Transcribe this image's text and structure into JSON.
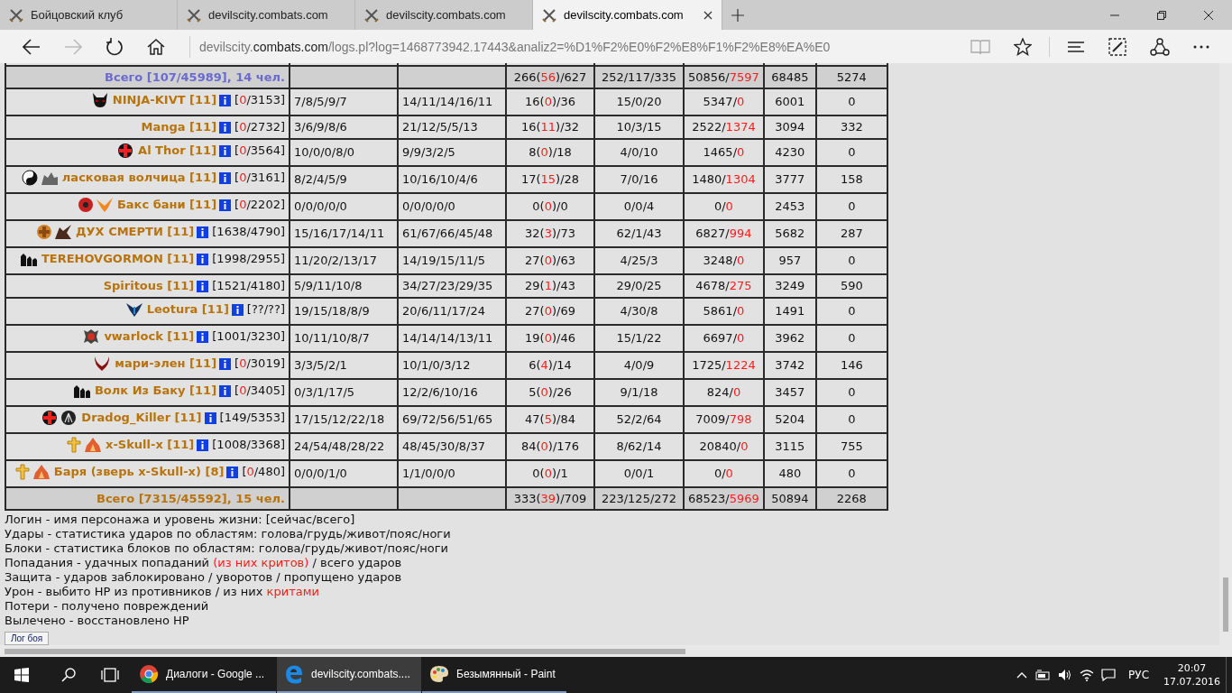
{
  "browser": {
    "tabs": [
      {
        "label": "Бойцовский клуб",
        "selected": false
      },
      {
        "label": "devilscity.combats.com",
        "selected": false
      },
      {
        "label": "devilscity.combats.com",
        "selected": false
      },
      {
        "label": "devilscity.combats.com",
        "selected": true
      }
    ],
    "address": {
      "prefix": "devilscity.",
      "domain": "combats.com",
      "rest": "/logs.pl?log=1468773942.17443&analiz2=%D1%F2%E0%F2%E8%F1%F2%E8%EA%E0"
    }
  },
  "table": {
    "rows": [
      {
        "kind": "total",
        "label": "Всего [107/45989], 14 чел.",
        "color": "#6a6ad0",
        "hit": "266(",
        "crit": "56",
        "attempts": ")/627",
        "defense": "252/117/335",
        "damage": "50856/",
        "crit_damage": "7597",
        "losses": "68485",
        "healed": "5274"
      },
      {
        "kind": "player",
        "emblems": [
          {
            "kind": "demon"
          }
        ],
        "name": "NINJA-KIVT [11]",
        "hp_open": "[",
        "hp": "0",
        "hp_rest": "/3153]",
        "dead": true,
        "hits": "7/8/5/9/7",
        "blocks": "14/11/14/16/11",
        "hit": "16(",
        "crit": "0",
        "attempts": ")/36",
        "defense": "15/0/20",
        "damage": "5347/",
        "crit_damage": "0",
        "losses": "6001",
        "healed": "0"
      },
      {
        "kind": "player",
        "emblems": [],
        "name": "Manga [11]",
        "hp_open": "[",
        "hp": "0",
        "hp_rest": "/2732]",
        "dead": true,
        "hits": "3/6/9/8/6",
        "blocks": "21/12/5/5/13",
        "hit": "16(",
        "crit": "11",
        "attempts": ")/32",
        "defense": "10/3/15",
        "damage": "2522/",
        "crit_damage": "1374",
        "losses": "3094",
        "healed": "332"
      },
      {
        "kind": "player",
        "emblems": [
          {
            "kind": "cross"
          }
        ],
        "name": "Al Thor [11]",
        "hp_open": "[",
        "hp": "0",
        "hp_rest": "/3564]",
        "dead": true,
        "hits": "10/0/0/8/0",
        "blocks": "9/9/3/2/5",
        "hit": "8(",
        "crit": "0",
        "attempts": ")/18",
        "defense": "4/0/10",
        "damage": "1465/",
        "crit_damage": "0",
        "losses": "4230",
        "healed": "0"
      },
      {
        "kind": "player",
        "emblems": [
          {
            "kind": "yinyang"
          },
          {
            "kind": "wolf"
          }
        ],
        "name": "ласковая волчица [11]",
        "hp_open": "[",
        "hp": "0",
        "hp_rest": "/3161]",
        "dead": true,
        "hits": "8/2/4/5/9",
        "blocks": "10/16/10/4/6",
        "hit": "17(",
        "crit": "15",
        "attempts": ")/28",
        "defense": "7/0/16",
        "damage": "1480/",
        "crit_damage": "1304",
        "losses": "3777",
        "healed": "158"
      },
      {
        "kind": "player",
        "emblems": [
          {
            "kind": "orb"
          },
          {
            "kind": "phoenix"
          }
        ],
        "name": "Бакс бани [11]",
        "hp_open": "[",
        "hp": "0",
        "hp_rest": "/2202]",
        "dead": true,
        "hits": "0/0/0/0/0",
        "blocks": "0/0/0/0/0",
        "hit": "0(",
        "crit": "0",
        "attempts": ")/0",
        "defense": "0/0/4",
        "damage": "0/",
        "crit_damage": "0",
        "losses": "2453",
        "healed": "0"
      },
      {
        "kind": "player",
        "emblems": [
          {
            "kind": "badge"
          },
          {
            "kind": "dragon"
          }
        ],
        "name": "ДУХ СМЕРТИ [11]",
        "hp_open": "[",
        "hp": "1638",
        "hp_rest": "/4790]",
        "dead": false,
        "hits": "15/16/17/14/11",
        "blocks": "61/67/66/45/48",
        "hit": "32(",
        "crit": "3",
        "attempts": ")/73",
        "defense": "62/1/43",
        "damage": "6827/",
        "crit_damage": "994",
        "losses": "5682",
        "healed": "287"
      },
      {
        "kind": "player",
        "emblems": [
          {
            "kind": "figures"
          }
        ],
        "name": "TEREHOVGORMON [11]",
        "hp_open": "[",
        "hp": "1998",
        "hp_rest": "/2955]",
        "dead": false,
        "hits": "11/20/2/13/17",
        "blocks": "14/19/15/11/5",
        "hit": "27(",
        "crit": "0",
        "attempts": ")/63",
        "defense": "4/25/3",
        "damage": "3248/",
        "crit_damage": "0",
        "losses": "957",
        "healed": "0"
      },
      {
        "kind": "player",
        "emblems": [],
        "name": "Spiritous [11]",
        "hp_open": "[",
        "hp": "1521",
        "hp_rest": "/4180]",
        "dead": false,
        "hits": "5/9/11/10/8",
        "blocks": "34/27/23/29/35",
        "hit": "29(",
        "crit": "1",
        "attempts": ")/43",
        "defense": "29/0/25",
        "damage": "4678/",
        "crit_damage": "275",
        "losses": "3249",
        "healed": "590"
      },
      {
        "kind": "player",
        "emblems": [
          {
            "kind": "wings"
          }
        ],
        "name": "Leotura [11]",
        "hp_open": "[",
        "hp": "??",
        "hp_rest": "/??]",
        "dead": false,
        "hits": "19/15/18/8/9",
        "blocks": "20/6/11/17/24",
        "hit": "27(",
        "crit": "0",
        "attempts": ")/69",
        "defense": "4/30/8",
        "damage": "5861/",
        "crit_damage": "0",
        "losses": "1491",
        "healed": "0"
      },
      {
        "kind": "player",
        "emblems": [
          {
            "kind": "spiked"
          }
        ],
        "name": "vwarlock [11]",
        "hp_open": "[",
        "hp": "1001",
        "hp_rest": "/3230]",
        "dead": false,
        "hits": "10/11/10/8/7",
        "blocks": "14/14/14/13/11",
        "hit": "19(",
        "crit": "0",
        "attempts": ")/46",
        "defense": "15/1/22",
        "damage": "6697/",
        "crit_damage": "0",
        "losses": "3962",
        "healed": "0"
      },
      {
        "kind": "player",
        "emblems": [
          {
            "kind": "horns"
          }
        ],
        "name": "мари-элен [11]",
        "hp_open": "[",
        "hp": "0",
        "hp_rest": "/3019]",
        "dead": true,
        "hits": "3/3/5/2/1",
        "blocks": "10/1/0/3/12",
        "hit": "6(",
        "crit": "4",
        "attempts": ")/14",
        "defense": "4/0/9",
        "damage": "1725/",
        "crit_damage": "1224",
        "losses": "3742",
        "healed": "146"
      },
      {
        "kind": "player",
        "emblems": [
          {
            "kind": "figures"
          }
        ],
        "name": "Волк Из Баку [11]",
        "hp_open": "[",
        "hp": "0",
        "hp_rest": "/3405]",
        "dead": true,
        "hits": "0/3/1/17/5",
        "blocks": "12/2/6/10/16",
        "hit": "5(",
        "crit": "0",
        "attempts": ")/26",
        "defense": "9/1/18",
        "damage": "824/",
        "crit_damage": "0",
        "losses": "3457",
        "healed": "0"
      },
      {
        "kind": "player",
        "emblems": [
          {
            "kind": "cross"
          },
          {
            "kind": "disc"
          }
        ],
        "name": "Dradog_Killer [11]",
        "hp_open": "[",
        "hp": "149",
        "hp_rest": "/5353]",
        "dead": false,
        "hits": "17/15/12/22/18",
        "blocks": "69/72/56/51/65",
        "hit": "47(",
        "crit": "5",
        "attempts": ")/84",
        "defense": "52/2/64",
        "damage": "7009/",
        "crit_damage": "798",
        "losses": "5204",
        "healed": "0"
      },
      {
        "kind": "player",
        "emblems": [
          {
            "kind": "ankh"
          },
          {
            "kind": "flame"
          }
        ],
        "name": "x-Skull-x [11]",
        "hp_open": "[",
        "hp": "1008",
        "hp_rest": "/3368]",
        "dead": false,
        "hits": "24/54/48/28/22",
        "blocks": "48/45/30/8/37",
        "hit": "84(",
        "crit": "0",
        "attempts": ")/176",
        "defense": "8/62/14",
        "damage": "20840/",
        "crit_damage": "0",
        "losses": "3115",
        "healed": "755"
      },
      {
        "kind": "player",
        "emblems": [
          {
            "kind": "ankh"
          },
          {
            "kind": "flame"
          }
        ],
        "name": "Баря (зверь x-Skull-x) [8]",
        "hp_open": "[",
        "hp": "0",
        "hp_rest": "/480]",
        "dead": true,
        "hits": "0/0/0/1/0",
        "blocks": "1/1/0/0/0",
        "hit": "0(",
        "crit": "0",
        "attempts": ")/1",
        "defense": "0/0/1",
        "damage": "0/",
        "crit_damage": "0",
        "losses": "480",
        "healed": "0"
      },
      {
        "kind": "total",
        "label": "Всего [7315/45592], 15 чел.",
        "color": "#b8730a",
        "hit": "333(",
        "crit": "39",
        "attempts": ")/709",
        "defense": "223/125/272",
        "damage": "68523/",
        "crit_damage": "5969",
        "losses": "50894",
        "healed": "2268"
      }
    ]
  },
  "legend": [
    [
      {
        "text": "Логин - имя персонажа и уровень жизни: [сейчас/всего]",
        "highlight": false
      }
    ],
    [
      {
        "text": "Удары - статистика ударов по областям: голова/грудь/живот/пояс/ноги",
        "highlight": false
      }
    ],
    [
      {
        "text": "Блоки - статистика блоков по областям: голова/грудь/живот/пояс/ноги",
        "highlight": false
      }
    ],
    [
      {
        "text": "Попадания - удачных попаданий ",
        "highlight": false
      },
      {
        "text": "(из них критов)",
        "highlight": true
      },
      {
        "text": " / всего ударов",
        "highlight": false
      }
    ],
    [
      {
        "text": "Защита - ударов заблокировано / уворотов / пропущено ударов",
        "highlight": false
      }
    ],
    [
      {
        "text": "Урон - выбито HP из противников / из них ",
        "highlight": false
      },
      {
        "text": "критами",
        "highlight": true
      }
    ],
    [
      {
        "text": "Потери - получено повреждений",
        "highlight": false
      }
    ],
    [
      {
        "text": "Вылечено - восстановлено HP",
        "highlight": false
      }
    ]
  ],
  "log_button": "Лог боя",
  "taskbar": {
    "items": [
      {
        "label": "Диалоги - Google ...",
        "kind": "chrome",
        "selected": false
      },
      {
        "label": "devilscity.combats....",
        "kind": "edge",
        "selected": true
      },
      {
        "label": "Безымянный - Paint",
        "kind": "paint",
        "selected": false
      }
    ],
    "language": "РУС",
    "time": "20:07",
    "date": "17.07.2016"
  }
}
